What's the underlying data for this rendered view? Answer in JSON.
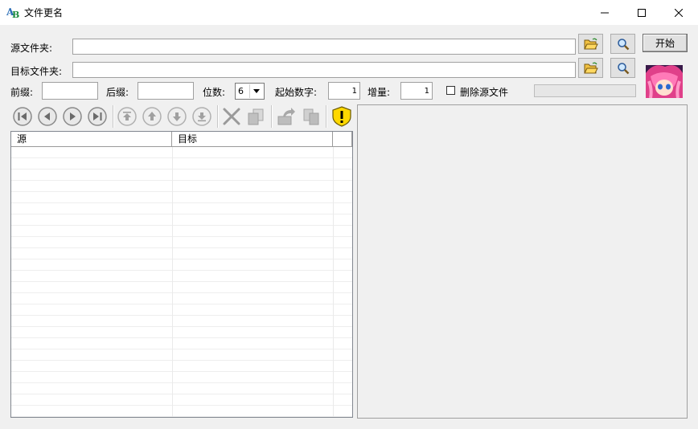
{
  "window": {
    "title": "文件更名",
    "icon": "ab-app-icon",
    "controls": [
      "minimize-icon",
      "maximize-icon",
      "close-icon"
    ]
  },
  "source_folder": {
    "label": "源文件夹:",
    "value": ""
  },
  "target_folder": {
    "label": "目标文件夹:",
    "value": ""
  },
  "start_button": {
    "label": "开始"
  },
  "options": {
    "prefix": {
      "label": "前缀:",
      "value": ""
    },
    "suffix": {
      "label": "后缀:",
      "value": ""
    },
    "digits": {
      "label": "位数:",
      "value": "6"
    },
    "start_number": {
      "label": "起始数字:",
      "value": "1"
    },
    "increment": {
      "label": "增量:",
      "value": "1"
    },
    "delete_source": {
      "label": "删除源文件",
      "checked": false
    }
  },
  "toolbar": {
    "icons": [
      "first-icon",
      "prev-icon",
      "next-icon",
      "last-icon",
      "move-top-icon",
      "move-up-icon",
      "move-down-icon",
      "move-bottom-icon",
      "delete-icon",
      "copy-to-icon",
      "export-icon",
      "copy-icon",
      "warning-icon"
    ]
  },
  "list": {
    "columns": [
      "源",
      "目标"
    ],
    "rows": []
  },
  "colors": {
    "nav_button": "#8a8a8a",
    "accent_warning": "#ffd800"
  }
}
